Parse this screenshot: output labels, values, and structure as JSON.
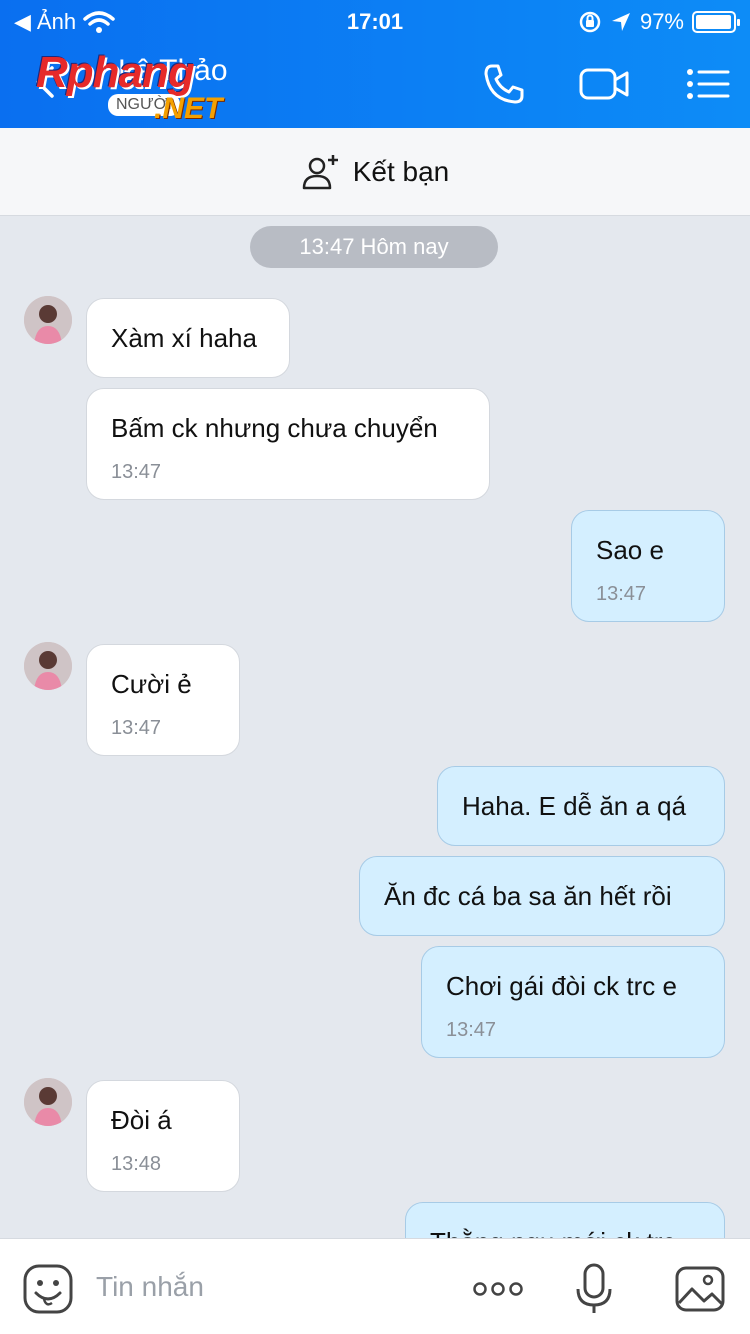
{
  "status_bar": {
    "back_app": "Ảnh",
    "time": "17:01",
    "battery": "97%",
    "battery_level": 0.97
  },
  "header": {
    "contact_name": "Lê Thảo",
    "watermark": {
      "main": "Rphang",
      "pill": "NGƯỜI",
      "net": ".NET"
    },
    "icons": [
      "phone-icon",
      "video-call-icon",
      "menu-list-icon"
    ]
  },
  "add_friend": {
    "label": "Kết bạn",
    "icon": "add-friend-icon"
  },
  "chat": {
    "date_divider": "13:47 Hôm nay",
    "messages": [
      {
        "dir": "in",
        "text": "Xàm xí haha",
        "time": ""
      },
      {
        "dir": "in",
        "text": "Bấm ck nhưng chưa chuyển",
        "time": "13:47"
      },
      {
        "dir": "out",
        "text": "Sao e",
        "time": "13:47"
      },
      {
        "dir": "in",
        "text": "Cười ẻ",
        "time": "13:47"
      },
      {
        "dir": "out",
        "text": "Haha. E dễ ăn a qá",
        "time": ""
      },
      {
        "dir": "out",
        "text": "Ăn đc cá ba sa ăn hết rồi",
        "time": ""
      },
      {
        "dir": "out",
        "text": "Chơi gái đòi ck trc e",
        "time": "13:47"
      },
      {
        "dir": "in",
        "text": "Đòi á",
        "time": "13:48"
      },
      {
        "dir": "out",
        "text": "Thằng ngu mới ck trc",
        "time": ""
      }
    ]
  },
  "input": {
    "placeholder": "Tin nhắn",
    "icons": [
      "emoji-icon",
      "more-dots-icon",
      "microphone-icon",
      "image-icon"
    ]
  },
  "colors": {
    "header": "#0a6ff0",
    "bubble_out": "#d4efff",
    "bubble_in": "#ffffff",
    "chat_bg": "#e4e8ee"
  }
}
